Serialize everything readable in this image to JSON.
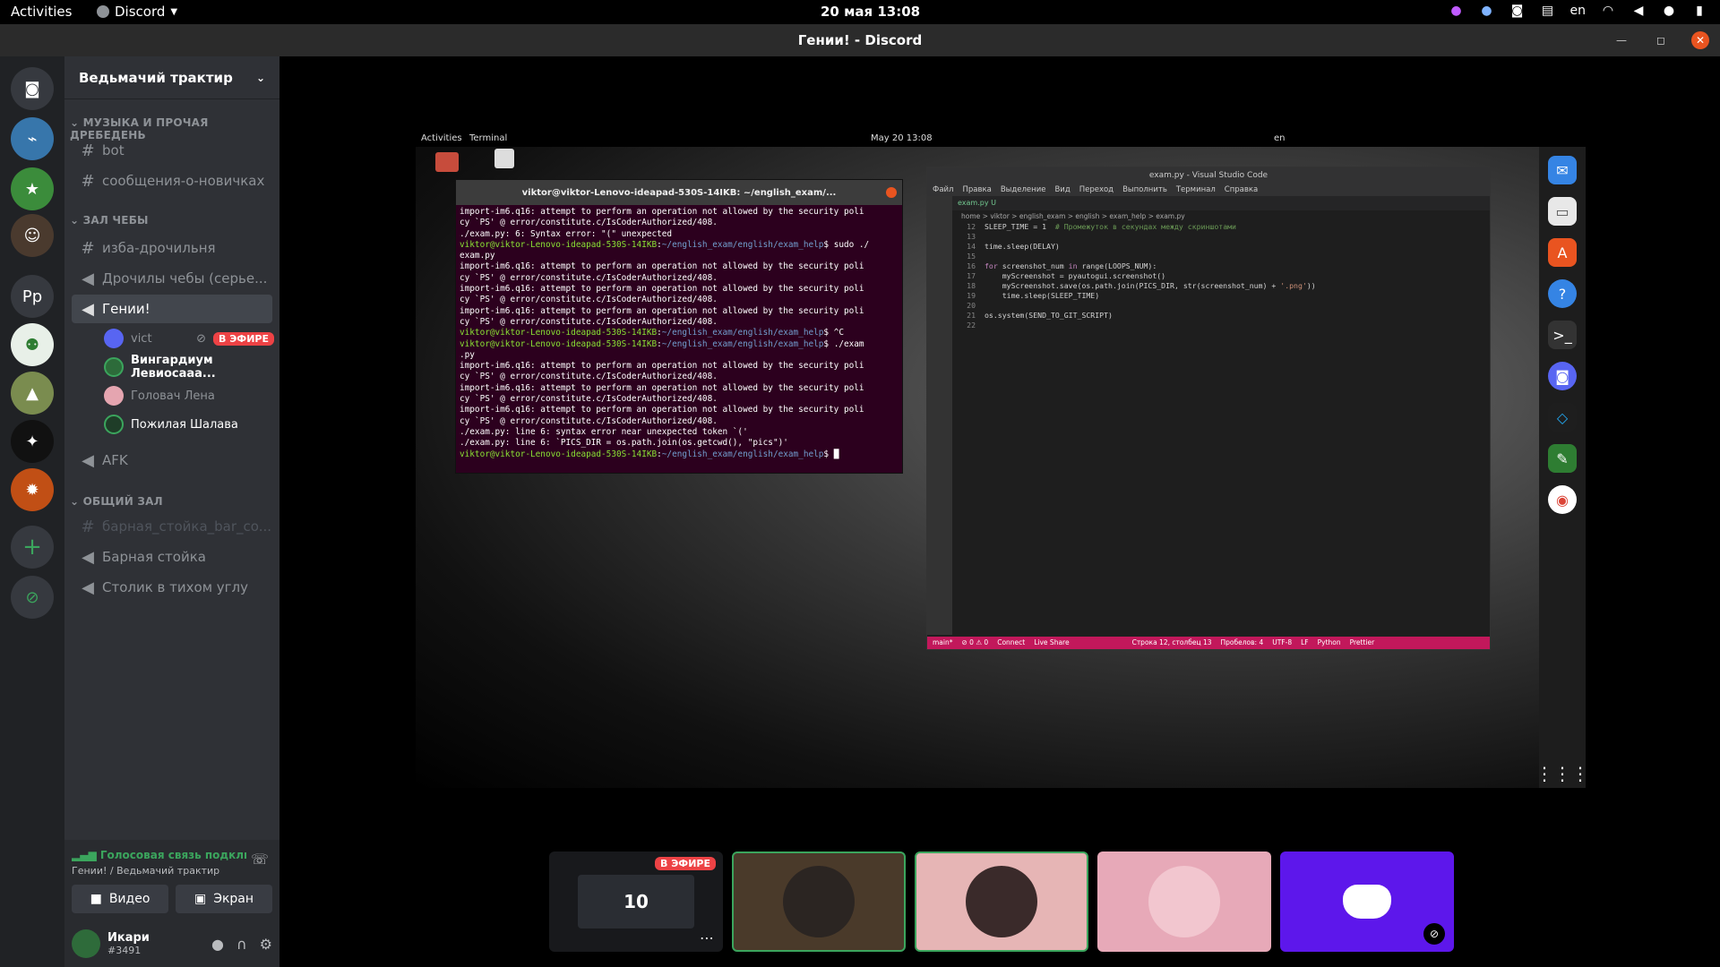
{
  "topbar": {
    "activities": "Activities",
    "app": "Discord",
    "clock": "20 мая  13:08",
    "lang": "en"
  },
  "window": {
    "title": "Гении! - Discord"
  },
  "guild": {
    "name": "Ведьмачий трактир"
  },
  "servers": [
    "discord-home",
    "python",
    "steam",
    "avatar-1",
    "Pp",
    "bot-green",
    "landscape",
    "neon",
    "orange",
    "add",
    "explore"
  ],
  "categories": [
    {
      "name": "МУЗЫКА И ПРОЧАЯ ДРЕБЕДЕНЬ"
    },
    {
      "name": "ЗАЛ ЧЕБЫ"
    },
    {
      "name": "ОБЩИЙ ЗАЛ"
    }
  ],
  "channels": {
    "bot": "bot",
    "newbies": "сообщения-о-новичках",
    "izba": "изба-дрочильня",
    "drochily": "Дрочилы чебы (серье...",
    "genii": "Гении!",
    "afk": "AFK",
    "bar_co": "барная_стойка_bar_co...",
    "bar": "Барная стойка",
    "table": "Столик в тихом углу"
  },
  "voice_users": [
    {
      "name": "vict",
      "live": "В ЭФИРЕ"
    },
    {
      "name": "Вингардиум Левиосааа..."
    },
    {
      "name": "Головач Лена"
    },
    {
      "name": "Пожилая Шалава"
    }
  ],
  "voice_panel": {
    "status": "Голосовая связь подключ",
    "location": "Гении! / Ведьмачий трактир",
    "video": "Видео",
    "screen": "Экран"
  },
  "user": {
    "name": "Икари",
    "tag": "#3491"
  },
  "shared_screen": {
    "activities": "Activities",
    "terminal_menu": "Terminal",
    "clock": "May 20  13:08",
    "lang": "en",
    "terminal": {
      "title": "viktor@viktor-Lenovo-ideapad-530S-14IKB: ~/english_exam/...",
      "prompt": "viktor@viktor-Lenovo-ideapad-530S-14IKB:~/english_exam/english/exam_help$"
    },
    "vscode": {
      "title": "exam.py - Visual Studio Code",
      "menu": [
        "Файл",
        "Правка",
        "Выделение",
        "Вид",
        "Переход",
        "Выполнить",
        "Терминал",
        "Справка"
      ],
      "tab": "exam.py U",
      "breadcrumbs": "home > viktor > english_exam > english > exam_help > exam.py",
      "status": [
        "main*",
        "⊘ 0 ⚠ 0",
        "Connect",
        "Live Share",
        "Строка 12, столбец 13",
        "Пробелов: 4",
        "UTF-8",
        "LF",
        "Python",
        "Prettier"
      ]
    }
  },
  "tiles": [
    {
      "live": "В ЭФИРЕ",
      "number": "10"
    }
  ]
}
